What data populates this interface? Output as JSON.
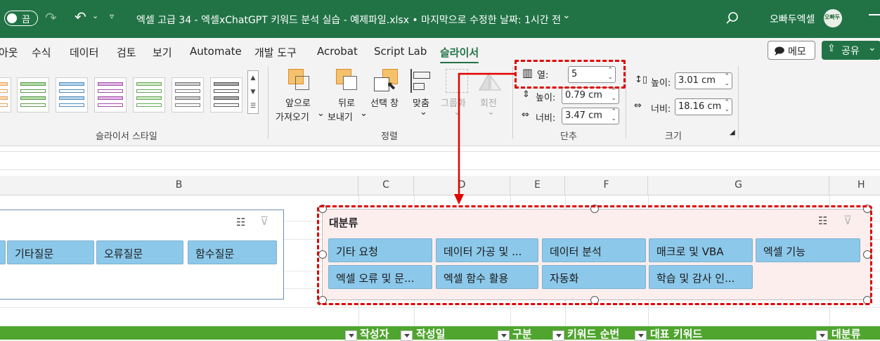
{
  "titlebar": {
    "autosave_label": "끔",
    "title": "엑셀 고급 34 - 엑셀xChatGPT 키워드 분석 실습 - 예제파일.xlsx • 마지막으로 수정한 날짜: 1시간 전",
    "user": "오빠두엑셀",
    "avatar_text": "오빠두"
  },
  "tabs": [
    "아웃",
    "수식",
    "데이터",
    "검토",
    "보기",
    "Automate",
    "개발 도구",
    "Acrobat",
    "Script Lab",
    "슬라이서"
  ],
  "active_tab": "슬라이서",
  "top_buttons": {
    "memo": "메모",
    "share": "공유"
  },
  "ribbon": {
    "styles_group": "슬라이서 스타일",
    "arrange_group": "정렬",
    "bring_forward": [
      "앞으로",
      "가져오기"
    ],
    "send_backward": [
      "뒤로",
      "보내기"
    ],
    "selection_pane": "선택 창",
    "align": "맞춤",
    "group": "그룹화",
    "rotate": "회전",
    "buttons_group": "단추",
    "columns_label": "열:",
    "columns_value": "5",
    "btn_height_label": "높이:",
    "btn_height_value": "0.79 cm",
    "btn_width_label": "너비:",
    "btn_width_value": "3.47 cm",
    "size_group": "크기",
    "height_label": "높이:",
    "height_value": "3.01 cm",
    "width_label": "너비:",
    "width_value": "18.16 cm"
  },
  "columns": [
    "B",
    "C",
    "D",
    "E",
    "F",
    "G",
    "H"
  ],
  "left_slicer": {
    "items": [
      "기타질문",
      "오류질문",
      "함수질문"
    ]
  },
  "main_slicer": {
    "title": "대분류",
    "items": [
      "기타 요청",
      "데이터 가공 및 ...",
      "데이터 분석",
      "매크로 및 VBA",
      "엑셀 기능",
      "엑셀 오류 및 문...",
      "엑셀 함수 활용",
      "자동화",
      "학습 및 감사 인..."
    ]
  },
  "table_headers": [
    "작성자",
    "작성일",
    "구분",
    "키워드 순번",
    "대표 키워드",
    "대분류"
  ],
  "colors": {
    "excel_green": "#217346",
    "slicer_button": "#8cc8ea",
    "highlight_red": "#e00000",
    "table_header": "#4fa52e"
  }
}
